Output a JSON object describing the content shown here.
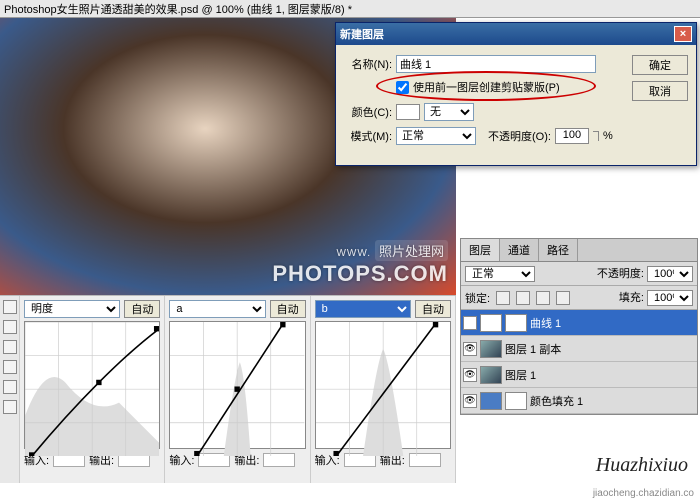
{
  "title_bar": "Photoshop女生照片通透甜美的效果.psd @ 100% (曲线 1, 图层蒙版/8) *",
  "watermark": {
    "www": "WWW.",
    "cn": "照片处理网",
    "site": "PHOTOPS.COM"
  },
  "dialog": {
    "title": "新建图层",
    "name_label": "名称(N):",
    "name_value": "曲线 1",
    "clip_checkbox": "使用前一图层创建剪贴蒙版(P)",
    "color_label": "颜色(C):",
    "color_value": "无",
    "mode_label": "模式(M):",
    "mode_value": "正常",
    "opacity_label": "不透明度(O):",
    "opacity_value": "100",
    "opacity_unit": "%",
    "ok": "确定",
    "cancel": "取消"
  },
  "curves": {
    "auto": "自动",
    "input_label": "输入:",
    "output_label": "输出:",
    "panels": [
      {
        "channel": "明度",
        "active": false
      },
      {
        "channel": "a",
        "active": false
      },
      {
        "channel": "b",
        "active": true
      }
    ]
  },
  "layers_panel": {
    "tabs": [
      "图层",
      "通道",
      "路径"
    ],
    "active_tab": 0,
    "blend_mode": "正常",
    "opacity_label": "不透明度:",
    "opacity": "100%",
    "lock_label": "锁定:",
    "fill_label": "填充:",
    "fill": "100%",
    "layers": [
      {
        "name": "曲线 1",
        "type": "curves",
        "active": true
      },
      {
        "name": "图层 1 副本",
        "type": "image",
        "active": false
      },
      {
        "name": "图层 1",
        "type": "image",
        "active": false
      },
      {
        "name": "颜色填充 1",
        "type": "fill",
        "active": false
      }
    ]
  },
  "signature": "Huazhixiuo",
  "footer": "jiaocheng.chazidian.co"
}
